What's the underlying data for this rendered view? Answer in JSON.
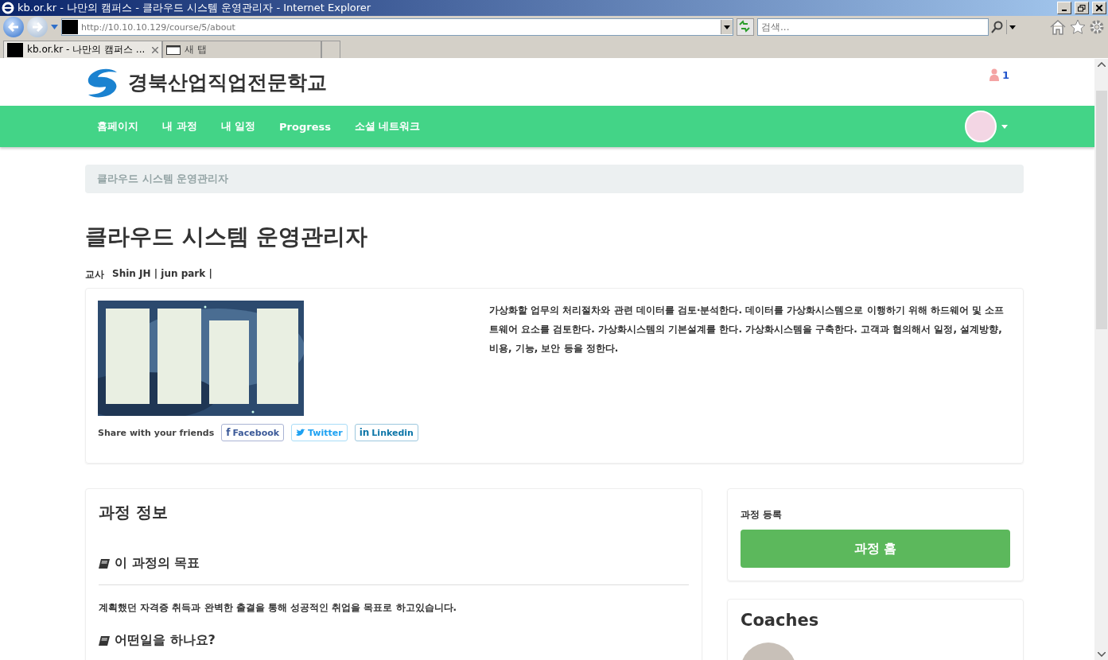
{
  "browser": {
    "title": "kb.or.kr - 나만의 캠퍼스 - 클라우드 시스템 운영관리자 - Internet Explorer",
    "url": "http://10.10.10.129/course/5/about",
    "search_placeholder": "검색...",
    "tabs": [
      {
        "label": "kb.or.kr - 나만의 캠퍼스 ...",
        "selected": true
      },
      {
        "label": "새 탭",
        "selected": false
      }
    ]
  },
  "header": {
    "logo_text": "경북산업직업전문학교",
    "notification_count": "1"
  },
  "nav": {
    "items": [
      {
        "label": "홈페이지"
      },
      {
        "label": "내 과정"
      },
      {
        "label": "내 일정"
      },
      {
        "label": "Progress"
      },
      {
        "label": "소셜 네트워크"
      }
    ]
  },
  "breadcrumb": "클라우드 시스템 운영관리자",
  "course": {
    "title": "클라우드 시스템 운영관리자",
    "teacher_label": "교사",
    "teachers": "Shin JH | jun park |",
    "share_label": "Share with your friends",
    "share_buttons": [
      {
        "kind": "facebook",
        "glyph": "f",
        "label": "Facebook"
      },
      {
        "kind": "twitter",
        "label": "Twitter"
      },
      {
        "kind": "linkedin",
        "glyph": "in",
        "label": "Linkedin"
      }
    ],
    "description": "가상화할 업무의 처리절차와 관련 데이터를 검토·분석한다. 데이터를 가상화시스템으로 이행하기 위해 하드웨어 및 소프트웨어 요소를 검토한다. 가상화시스템의 기본설계를 한다. 가상화시스템을 구축한다. 고객과 협의해서 일정, 설계방향, 비용, 기능, 보안 등을 정한다."
  },
  "info": {
    "title": "과정 정보",
    "sections": [
      {
        "heading": "이 과정의 목표",
        "text": "계획했던 자격증 취득과 완벽한 출결을 통해 성공적인 취업을 목표로 하고있습니다."
      },
      {
        "heading": "어떤일을 하나요?"
      }
    ]
  },
  "enroll": {
    "label": "과정 등록",
    "button": "과정 홈"
  },
  "coaches": {
    "title": "Coaches"
  }
}
